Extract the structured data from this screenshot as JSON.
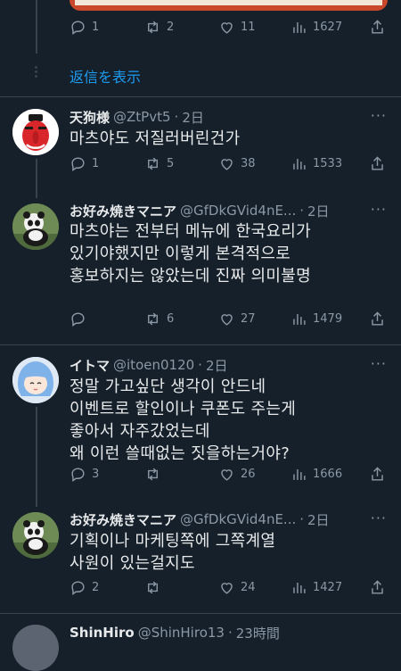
{
  "top_tweet": {
    "reply_count": "1",
    "retweet_count": "2",
    "like_count": "11",
    "view_count": "1627"
  },
  "show_replies_label": "返信を表示",
  "tweets": [
    {
      "name": "天狗様",
      "handle": "@ZtPvt5",
      "sep": "·",
      "time": "2日",
      "lines": [
        "마츠야도 저질러버린건가"
      ],
      "reply_count": "1",
      "retweet_count": "5",
      "like_count": "38",
      "view_count": "1533"
    },
    {
      "name": "お好み焼きマニア",
      "handle": "@GfDkGVid4nE...",
      "sep": "·",
      "time": "2日",
      "lines": [
        "마츠야는 전부터 메뉴에 한국요리가",
        "있기야했지만 이렇게 본격적으로",
        "홍보하지는 않았는데 진짜 의미불명"
      ],
      "reply_count": "",
      "retweet_count": "6",
      "like_count": "27",
      "view_count": "1479"
    },
    {
      "name": "イトマ",
      "handle": "@itoen0120",
      "sep": "·",
      "time": "2日",
      "lines": [
        "정말 가고싶단 생각이 안드네",
        "이벤트로 할인이나 쿠폰도 주는게",
        "좋아서 자주갔었는데",
        "왜 이런 쓸때없는 짓을하는거야?"
      ],
      "reply_count": "3",
      "retweet_count": "",
      "like_count": "26",
      "view_count": "1666"
    },
    {
      "name": "お好み焼きマニア",
      "handle": "@GfDkGVid4nE...",
      "sep": "·",
      "time": "2日",
      "lines": [
        "기획이나 마케팅쪽에 그쪽계열",
        "사원이 있는걸지도"
      ],
      "reply_count": "2",
      "retweet_count": "",
      "like_count": "24",
      "view_count": "1427"
    }
  ],
  "bottom_tweet": {
    "name": "ShinHiro",
    "handle": "@ShinHiro13",
    "sep": "·",
    "time": "23時間"
  },
  "more_label": "···",
  "colors": {
    "background": "#15202b",
    "text": "#e7e9ea",
    "muted": "#8b98a5",
    "link": "#1d9bf0"
  }
}
